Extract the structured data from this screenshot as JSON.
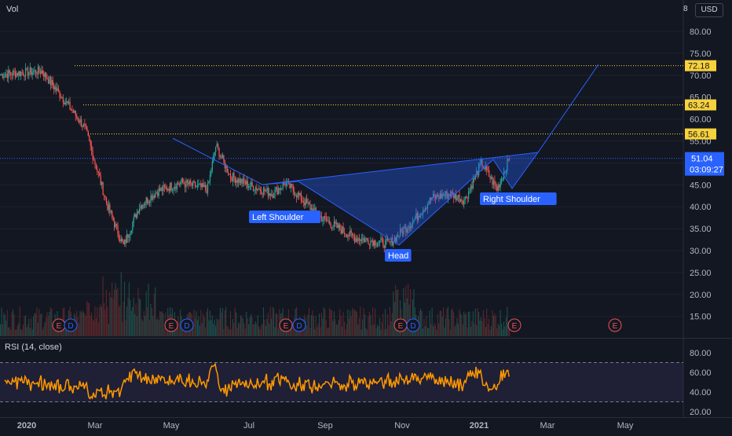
{
  "header": {
    "vol_label": "Vol",
    "currency": "USD",
    "auto_scale_label": "8"
  },
  "rsi_header": {
    "label": "RSI (14, close)"
  },
  "colors": {
    "background": "#131722",
    "up": "#26a69a",
    "down": "#ef5350",
    "pattern": "#2962ff",
    "rsi": "#ff9800",
    "rsi_band": "#7e57c2",
    "level_line": "#f7d23c",
    "label_bg": "#2962ff",
    "grid": "#1e222d"
  },
  "price_axis": {
    "ticks": [
      "80.00",
      "75.00",
      "70.00",
      "65.00",
      "60.00",
      "55.00",
      "50.00",
      "45.00",
      "40.00",
      "35.00",
      "30.00",
      "25.00",
      "20.00",
      "15.00"
    ],
    "level_labels": [
      "72.18",
      "63.24",
      "56.61"
    ],
    "current_price": "51.04",
    "countdown": "03:09:27"
  },
  "rsi_axis": {
    "ticks": [
      "80.00",
      "60.00",
      "40.00",
      "20.00"
    ]
  },
  "time_axis": {
    "labels": [
      "2020",
      "Mar",
      "May",
      "Jul",
      "Sep",
      "Nov",
      "2021",
      "Mar",
      "May"
    ],
    "bold": [
      true,
      false,
      false,
      false,
      false,
      false,
      true,
      false,
      false
    ]
  },
  "annotations": {
    "left_shoulder": "Left Shoulder",
    "head": "Head",
    "right_shoulder": "Right Shoulder"
  },
  "earnings_markers": [
    "E",
    "D",
    "E",
    "D",
    "E",
    "D",
    "E",
    "D",
    "E",
    "E"
  ],
  "chart_data": {
    "type": "candlestick",
    "price_levels": [
      72.18,
      63.24,
      56.61
    ],
    "current_price": 51.04,
    "ylim": [
      12,
      82
    ],
    "x_range": [
      "2019-12",
      "2021-06"
    ],
    "price_path": [
      {
        "x": "2019-12-05",
        "y": 70.0
      },
      {
        "x": "2020-01-15",
        "y": 71.0
      },
      {
        "x": "2020-02-01",
        "y": 65.0
      },
      {
        "x": "2020-02-20",
        "y": 58.0
      },
      {
        "x": "2020-03-10",
        "y": 40.0
      },
      {
        "x": "2020-03-23",
        "y": 31.0
      },
      {
        "x": "2020-04-05",
        "y": 40.0
      },
      {
        "x": "2020-04-20",
        "y": 43.5
      },
      {
        "x": "2020-05-10",
        "y": 45.5
      },
      {
        "x": "2020-06-01",
        "y": 44.0
      },
      {
        "x": "2020-06-08",
        "y": 54.0
      },
      {
        "x": "2020-06-20",
        "y": 47.0
      },
      {
        "x": "2020-07-05",
        "y": 45.0
      },
      {
        "x": "2020-07-25",
        "y": 43.0
      },
      {
        "x": "2020-08-05",
        "y": 45.5
      },
      {
        "x": "2020-09-01",
        "y": 38.0
      },
      {
        "x": "2020-10-01",
        "y": 33.0
      },
      {
        "x": "2020-10-30",
        "y": 31.5
      },
      {
        "x": "2020-11-20",
        "y": 37.0
      },
      {
        "x": "2020-12-05",
        "y": 42.0
      },
      {
        "x": "2020-12-20",
        "y": 43.0
      },
      {
        "x": "2021-01-01",
        "y": 41.5
      },
      {
        "x": "2021-01-15",
        "y": 50.0
      },
      {
        "x": "2021-01-28",
        "y": 44.0
      },
      {
        "x": "2021-02-08",
        "y": 51.5
      }
    ],
    "rsi": {
      "levels": [
        70,
        30
      ],
      "ylim": [
        18,
        88
      ],
      "ticks": [
        80,
        60,
        40,
        20
      ]
    }
  }
}
